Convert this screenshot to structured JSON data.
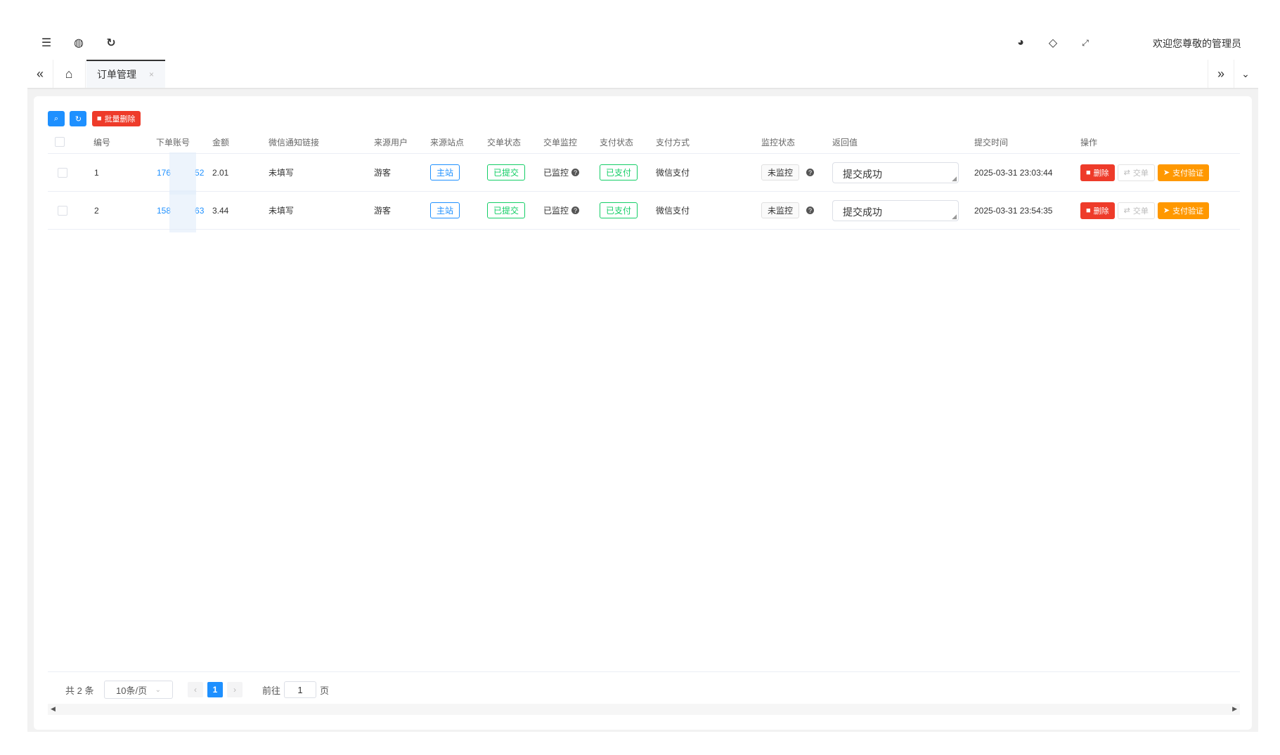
{
  "header": {
    "welcome": "欢迎您尊敬的管理员",
    "icons": [
      "menu-fold-icon",
      "globe-icon",
      "refresh-icon",
      "palette-icon",
      "tag-icon",
      "fullscreen-icon"
    ]
  },
  "tabs": {
    "active_label": "订单管理",
    "close_glyph": "×"
  },
  "toolbar": {
    "batch_delete_label": "批量删除"
  },
  "table": {
    "columns": [
      "编号",
      "下单账号",
      "金额",
      "微信通知链接",
      "来源用户",
      "来源站点",
      "交单状态",
      "交单监控",
      "支付状态",
      "支付方式",
      "监控状态",
      "返回值",
      "提交时间",
      "操作"
    ],
    "rows": [
      {
        "id": "1",
        "account": "176",
        "account_end": "52",
        "amount": "2.01",
        "wechat_link": "未填写",
        "source_user": "游客",
        "source_site": "主站",
        "submit_status": "已提交",
        "submit_monitor": "已监控",
        "pay_status": "已支付",
        "pay_method": "微信支付",
        "monitor_status": "未监控",
        "return_value": "提交成功",
        "submit_time": "2025-03-31 23:03:44"
      },
      {
        "id": "2",
        "account": "158",
        "account_end": "63",
        "amount": "3.44",
        "wechat_link": "未填写",
        "source_user": "游客",
        "source_site": "主站",
        "submit_status": "已提交",
        "submit_monitor": "已监控",
        "pay_status": "已支付",
        "pay_method": "微信支付",
        "monitor_status": "未监控",
        "return_value": "提交成功",
        "submit_time": "2025-03-31 23:54:35"
      }
    ],
    "actions": {
      "delete": "删除",
      "submit": "交单",
      "verify": "支付验证"
    }
  },
  "pagination": {
    "total": "共 2 条",
    "page_size": "10条/页",
    "current_page": "1",
    "goto_prefix": "前往",
    "goto_value": "1",
    "goto_suffix": "页"
  },
  "colors": {
    "primary": "#1e90ff",
    "danger": "#ee3b2a",
    "success": "#13ce66",
    "warning": "#ff9800"
  }
}
